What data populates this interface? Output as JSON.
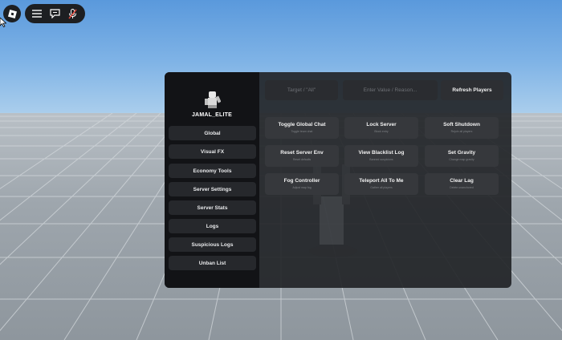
{
  "window": {
    "logo_icon": "roblox-logo-icon",
    "toolbar_icons": [
      "menu-icon",
      "chat-icon",
      "microphone-muted-icon"
    ]
  },
  "panel": {
    "username": "JAMAL_ELITE",
    "avatar_icon": "avatar-icon",
    "nav": [
      {
        "label": "Global"
      },
      {
        "label": "Visual FX"
      },
      {
        "label": "Economy Tools"
      },
      {
        "label": "Server Settings"
      },
      {
        "label": "Server Stats"
      },
      {
        "label": "Logs"
      },
      {
        "label": "Suspicious Logs"
      },
      {
        "label": "Unban List"
      }
    ],
    "target_placeholder": "Target / \"All\"",
    "value_placeholder": "Enter Value / Reason...",
    "refresh_label": "Refresh Players",
    "actions": [
      {
        "title": "Toggle Global Chat",
        "sub": "Toggle team chat"
      },
      {
        "title": "Lock Server",
        "sub": "Block entry"
      },
      {
        "title": "Soft Shutdown",
        "sub": "Rejoin all players"
      },
      {
        "title": "Reset Server Env",
        "sub": "Reset defaults"
      },
      {
        "title": "View Blacklist Log",
        "sub": "Banned suspicions"
      },
      {
        "title": "Set Gravity",
        "sub": "Change map gravity"
      },
      {
        "title": "Fog Controller",
        "sub": "Adjust map fog"
      },
      {
        "title": "Teleport All To Me",
        "sub": "Gather all players"
      },
      {
        "title": "Clear Lag",
        "sub": "Delete unanchored"
      }
    ]
  }
}
